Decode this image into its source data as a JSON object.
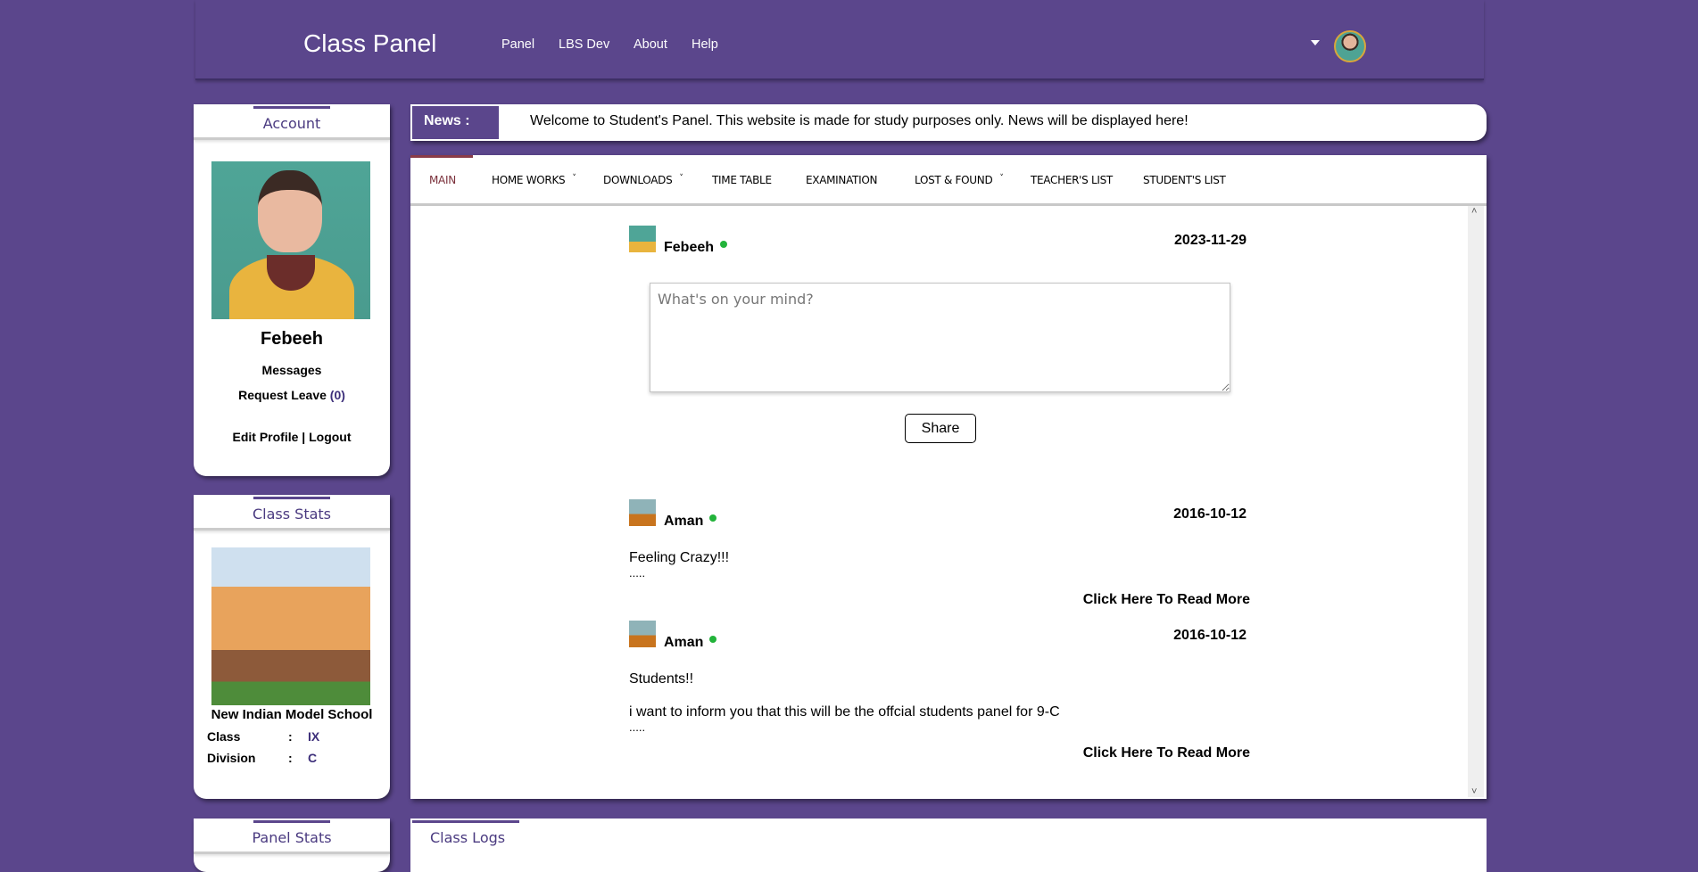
{
  "header": {
    "brand": "Class Panel",
    "nav": [
      "Panel",
      "LBS Dev",
      "About",
      "Help"
    ]
  },
  "account": {
    "title": "Account",
    "name": "Febeeh",
    "messages": "Messages",
    "request_leave": "Request Leave",
    "leave_count": "(0)",
    "edit_profile": "Edit Profile",
    "separator": "|",
    "logout": "Logout"
  },
  "class_stats": {
    "title": "Class Stats",
    "school": "New Indian Model School",
    "rows": [
      {
        "label": "Class",
        "sep": ":",
        "value": "IX"
      },
      {
        "label": "Division",
        "sep": ":",
        "value": "C"
      }
    ]
  },
  "panel_stats": {
    "title": "Panel Stats"
  },
  "class_logs": {
    "title": "Class Logs"
  },
  "news": {
    "label": "News :",
    "text": "Welcome to Student's Panel. This website is made for study purposes only. News will be displayed here!"
  },
  "tabs": [
    "MAIN",
    "HOME WORKS",
    "DOWNLOADS",
    "TIME TABLE",
    "EXAMINATION",
    "LOST & FOUND",
    "TEACHER'S LIST",
    "STUDENT'S LIST"
  ],
  "composer": {
    "user": "Febeeh",
    "date": "2023-11-29",
    "placeholder": "What's on your mind?",
    "share": "Share"
  },
  "posts": [
    {
      "user": "Aman",
      "date": "2016-10-12",
      "lines": [
        "Feeling Crazy!!!"
      ],
      "ellipsis": ".....",
      "more": "Click Here To Read More"
    },
    {
      "user": "Aman",
      "date": "2016-10-12",
      "lines": [
        "Students!!",
        "i want to inform you that this will be the offcial students panel for 9-C"
      ],
      "ellipsis": ".....",
      "more": "Click Here To Read More"
    }
  ],
  "colors": {
    "brand": "#5b468c",
    "online": "#22b33a",
    "active_tab": "#7a2f3a"
  }
}
